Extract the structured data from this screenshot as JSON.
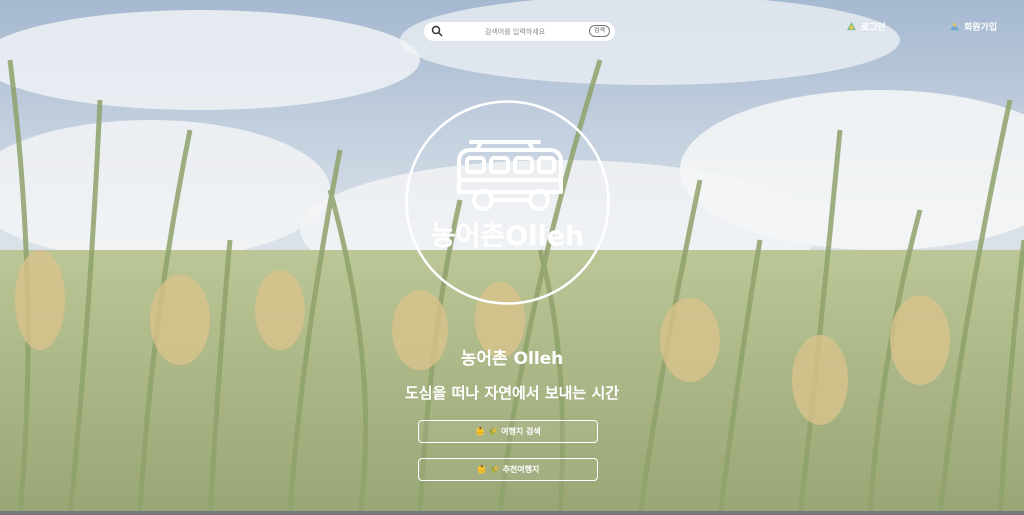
{
  "search": {
    "placeholder": "검색어를 입력하세요",
    "value": "",
    "button_label": "검색"
  },
  "nav": {
    "login_label": "로그인",
    "signup_label": "회원가입"
  },
  "logo": {
    "text": "농어촌Olleh"
  },
  "hero": {
    "title": "농어촌 Olleh",
    "subtitle": "도심을 떠나 자연에서 보내는 시간"
  },
  "actions": [
    {
      "label": "여행지 검색",
      "icons": [
        "👶",
        "🌾"
      ]
    },
    {
      "label": "추천여행지",
      "icons": [
        "👶",
        "🌾"
      ]
    }
  ]
}
